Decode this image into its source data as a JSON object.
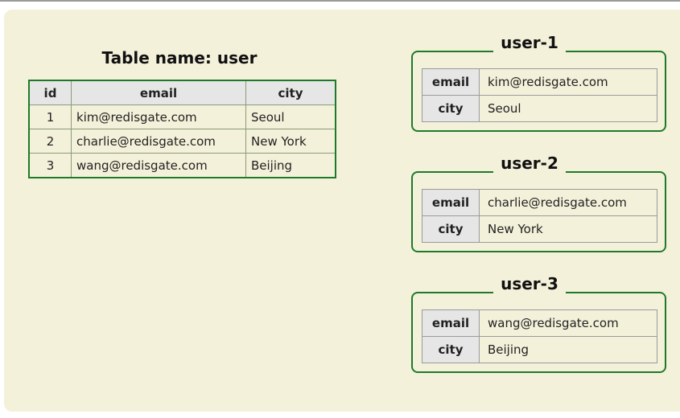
{
  "table": {
    "title": "Table name: user",
    "headers": [
      "id",
      "email",
      "city"
    ],
    "rows": [
      [
        "1",
        "kim@redisgate.com",
        "Seoul"
      ],
      [
        "2",
        "charlie@redisgate.com",
        "New York"
      ],
      [
        "3",
        "wang@redisgate.com",
        "Beijing"
      ]
    ]
  },
  "hashes": [
    {
      "key": "user-1",
      "fields": [
        {
          "name": "email",
          "value": "kim@redisgate.com"
        },
        {
          "name": "city",
          "value": "Seoul"
        }
      ]
    },
    {
      "key": "user-2",
      "fields": [
        {
          "name": "email",
          "value": "charlie@redisgate.com"
        },
        {
          "name": "city",
          "value": "New York"
        }
      ]
    },
    {
      "key": "user-3",
      "fields": [
        {
          "name": "email",
          "value": "wang@redisgate.com"
        },
        {
          "name": "city",
          "value": "Beijing"
        }
      ]
    }
  ],
  "colors": {
    "background": "#f4f1da",
    "border": "#1e7a2a",
    "header": "#e6e6e6"
  }
}
